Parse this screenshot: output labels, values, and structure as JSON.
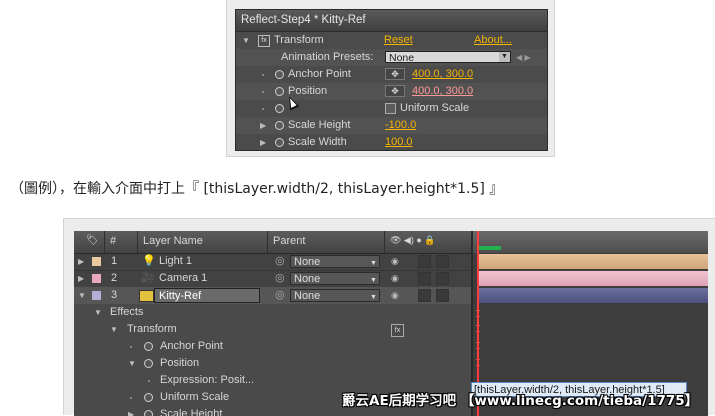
{
  "effect_controls": {
    "title": "Reflect-Step4 * Kitty-Ref",
    "transform": {
      "label": "Transform",
      "reset": "Reset",
      "about": "About..."
    },
    "animation_presets": {
      "label": "Animation Presets:",
      "value": "None"
    },
    "anchor_point": {
      "label": "Anchor Point",
      "value": "400.0, 300.0"
    },
    "position": {
      "label": "Position",
      "value": "400.0, 300.0"
    },
    "uniform_scale": {
      "label": "Uniform Scale"
    },
    "scale_height": {
      "label": "Scale Height",
      "value": "-100.0"
    },
    "scale_width": {
      "label": "Scale Width",
      "value": "100.0"
    }
  },
  "caption": "（圖例），在輸入介面中打上『 [thisLayer.width/2, thisLayer.height*1.5] 』",
  "timeline": {
    "headers": {
      "num": "#",
      "layer_name": "Layer Name",
      "parent": "Parent"
    },
    "layers": [
      {
        "num": "1",
        "name": "Light 1",
        "parent": "None",
        "label_color": "#e8c9a0",
        "bar_color": "#d8b184"
      },
      {
        "num": "2",
        "name": "Camera 1",
        "parent": "None",
        "label_color": "#e7a9bb",
        "bar_color": "#e6b2c1"
      },
      {
        "num": "3",
        "name": "Kitty-Ref",
        "parent": "None",
        "label_color": "#b3b0d6",
        "bar_color": "#5a5f8a"
      }
    ],
    "effects_label": "Effects",
    "transform_label": "Transform",
    "anchor_point_label": "Anchor Point",
    "position_label": "Position",
    "expression_label": "Expression: Posit...",
    "uniform_scale_label": "Uniform Scale",
    "scale_height_label": "Scale Height",
    "expression_text": "[thisLayer.width/2, thisLayer.height*1.5]"
  },
  "watermark": "爵云AE后期学习吧 【www.linecg.com/tieba/1775】",
  "colors": {
    "accent_link": "#f5b400",
    "keyed_value": "#ff9a9a",
    "playhead": "#ff3b3b",
    "work_area": "#22b14c"
  }
}
